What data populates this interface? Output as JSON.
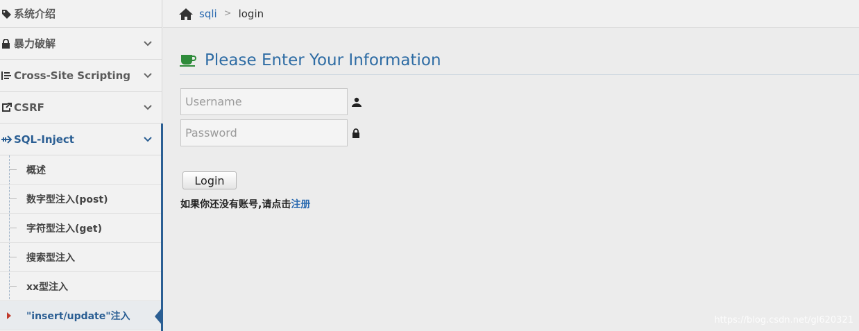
{
  "sidebar": {
    "items": [
      {
        "label": "系统介绍",
        "icon": "tag-icon"
      },
      {
        "label": "暴力破解",
        "icon": "lock-icon"
      },
      {
        "label": "Cross-Site Scripting",
        "icon": "list-icon"
      },
      {
        "label": "CSRF",
        "icon": "share-icon"
      },
      {
        "label": "SQL-Inject",
        "icon": "arrow-icon"
      }
    ],
    "subitems": [
      {
        "label": "概述"
      },
      {
        "label": "数字型注入(post)"
      },
      {
        "label": "字符型注入(get)"
      },
      {
        "label": "搜索型注入"
      },
      {
        "label": "xx型注入"
      },
      {
        "label": "\"insert/update\"注入"
      }
    ]
  },
  "breadcrumb": {
    "link": "sqli",
    "separator": ">",
    "current": "login"
  },
  "main": {
    "title": "Please Enter Your Information",
    "username_placeholder": "Username",
    "password_placeholder": "Password",
    "login_label": "Login",
    "register_prefix": "如果你还没有账号,请点击",
    "register_link": "注册"
  },
  "watermark": "https://blog.csdn.net/gl620321",
  "colors": {
    "accent": "#2a5e93",
    "link": "#2a6ab0",
    "title": "#2e6ca4",
    "header_icon": "#2e8b3a"
  }
}
